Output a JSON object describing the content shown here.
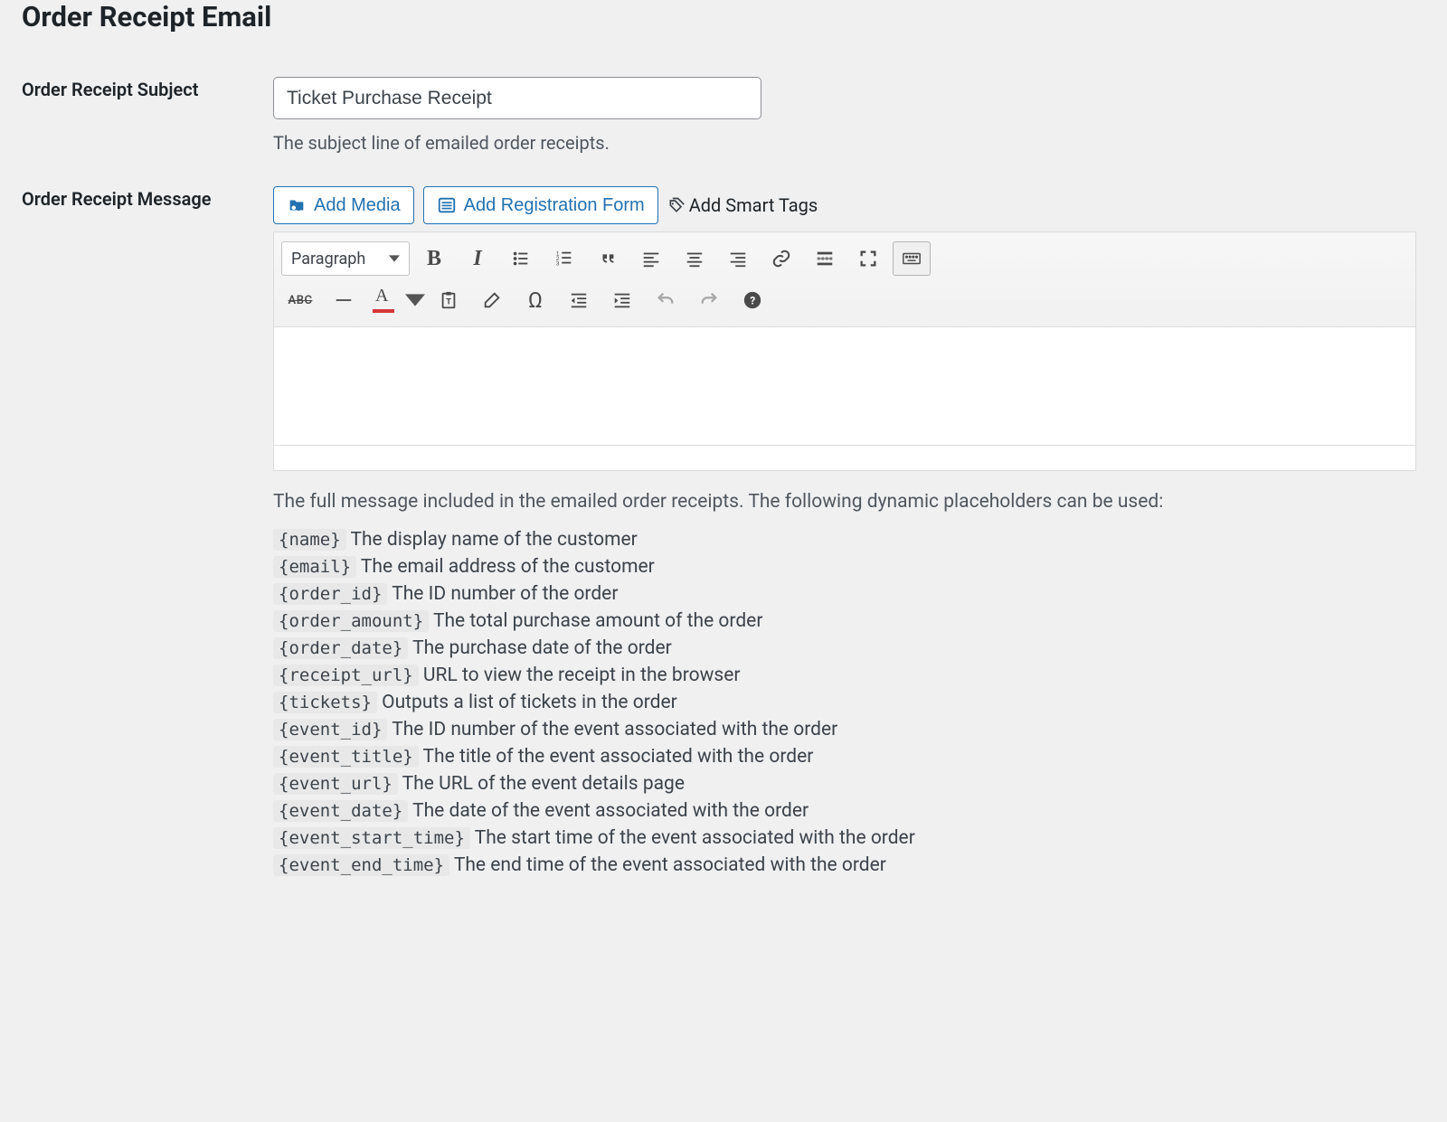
{
  "section_title": "Order Receipt Email",
  "subject": {
    "label": "Order Receipt Subject",
    "value": "Ticket Purchase Receipt",
    "help": "The subject line of emailed order receipts."
  },
  "message": {
    "label": "Order Receipt Message",
    "buttons": {
      "add_media": "Add Media",
      "add_registration_form": "Add Registration Form",
      "add_smart_tags": "Add Smart Tags"
    },
    "toolbar": {
      "format_select": "Paragraph"
    },
    "help_intro": "The full message included in the emailed order receipts. The following dynamic placeholders can be used:",
    "placeholders": [
      {
        "tag": "{name}",
        "desc": "The display name of the customer"
      },
      {
        "tag": "{email}",
        "desc": "The email address of the customer"
      },
      {
        "tag": "{order_id}",
        "desc": "The ID number of the order"
      },
      {
        "tag": "{order_amount}",
        "desc": "The total purchase amount of the order"
      },
      {
        "tag": "{order_date}",
        "desc": "The purchase date of the order"
      },
      {
        "tag": "{receipt_url}",
        "desc": "URL to view the receipt in the browser"
      },
      {
        "tag": "{tickets}",
        "desc": "Outputs a list of tickets in the order"
      },
      {
        "tag": "{event_id}",
        "desc": "The ID number of the event associated with the order"
      },
      {
        "tag": "{event_title}",
        "desc": "The title of the event associated with the order"
      },
      {
        "tag": "{event_url}",
        "desc": "The URL of the event details page"
      },
      {
        "tag": "{event_date}",
        "desc": "The date of the event associated with the order"
      },
      {
        "tag": "{event_start_time}",
        "desc": "The start time of the event associated with the order"
      },
      {
        "tag": "{event_end_time}",
        "desc": "The end time of the event associated with the order"
      }
    ]
  }
}
